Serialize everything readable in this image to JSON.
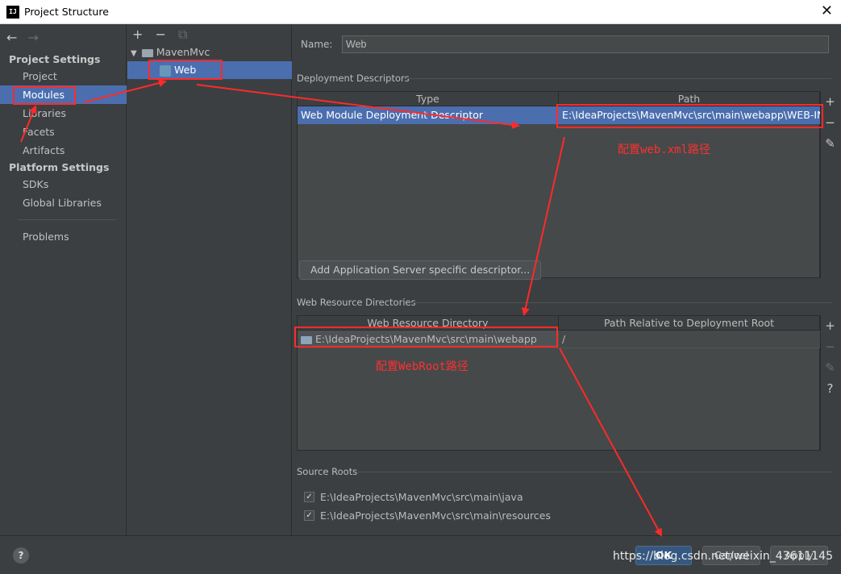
{
  "window": {
    "title": "Project Structure",
    "app_icon": "IJ",
    "close": "✕"
  },
  "nav": {
    "back": "←",
    "forward": "→"
  },
  "sidebar": {
    "project_settings_label": "Project Settings",
    "platform_settings_label": "Platform Settings",
    "items": [
      {
        "label": "Project"
      },
      {
        "label": "Modules",
        "selected": true
      },
      {
        "label": "Libraries"
      },
      {
        "label": "Facets"
      },
      {
        "label": "Artifacts"
      }
    ],
    "platform_items": [
      {
        "label": "SDKs"
      },
      {
        "label": "Global Libraries"
      }
    ],
    "problems": "Problems"
  },
  "tree": {
    "toolbar": {
      "add": "+",
      "remove": "−",
      "copy": "⧉"
    },
    "root": "MavenMvc",
    "child": "Web"
  },
  "details": {
    "name_label": "Name:",
    "name_value": "Web",
    "deployment_descriptors": {
      "label": "Deployment Descriptors",
      "columns": [
        "Type",
        "Path"
      ],
      "rows": [
        {
          "type": "Web Module Deployment Descriptor",
          "path": "E:\\IdeaProjects\\MavenMvc\\src\\main\\webapp\\WEB-INF"
        }
      ],
      "add_server_button": "Add Application Server specific descriptor..."
    },
    "web_resource_directories": {
      "label": "Web Resource Directories",
      "columns": [
        "Web Resource Directory",
        "Path Relative to Deployment Root"
      ],
      "rows": [
        {
          "directory": "E:\\IdeaProjects\\MavenMvc\\src\\main\\webapp",
          "relative": "/"
        }
      ]
    },
    "source_roots": {
      "label": "Source Roots",
      "items": [
        {
          "path": "E:\\IdeaProjects\\MavenMvc\\src\\main\\java",
          "checked": true
        },
        {
          "path": "E:\\IdeaProjects\\MavenMvc\\src\\main\\resources",
          "checked": true
        }
      ]
    },
    "side_tools": {
      "add": "+",
      "remove": "−",
      "edit": "✎",
      "help": "?"
    }
  },
  "annotations": {
    "web_xml": "配置web.xml路径",
    "web_root": "配置WebRoot路径"
  },
  "footer": {
    "help": "?",
    "ok": "OK",
    "cancel": "Cancel",
    "apply": "Apply",
    "watermark": "https://blog.csdn.net/weixin_43611145"
  },
  "colors": {
    "background": "#3c3f41",
    "selection": "#4b6eaf",
    "annotation": "#ff2a2a"
  }
}
